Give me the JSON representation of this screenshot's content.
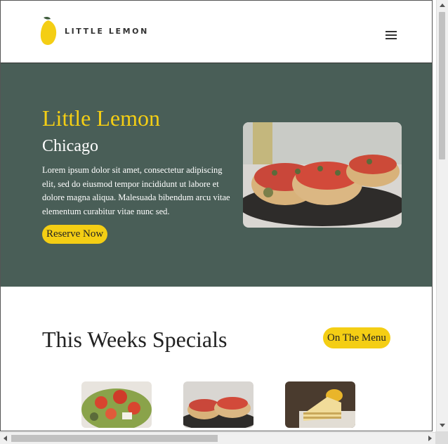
{
  "header": {
    "logo_text": "LITTLE LEMON",
    "logo_icon": "lemon-icon",
    "menu_icon": "hamburger-icon"
  },
  "hero": {
    "title": "Little Lemon",
    "city": "Chicago",
    "description": "Lorem ipsum dolor sit amet, consectetur adipiscing elit, sed do eiusmod tempor incididunt ut labore et dolore magna aliqua. Malesuada bibendum arcu vitae elementum curabitur vitae nunc sed.",
    "reserve_label": "Reserve Now",
    "image_icon": "bruschetta-photo"
  },
  "specials": {
    "title": "This Weeks Specials",
    "menu_label": "On The Menu",
    "cards": [
      {
        "image_icon": "greek-salad-photo"
      },
      {
        "image_icon": "bruschetta-photo"
      },
      {
        "image_icon": "lemon-dessert-photo"
      }
    ]
  },
  "colors": {
    "primary_green": "#495e57",
    "primary_yellow": "#f4ce14"
  }
}
